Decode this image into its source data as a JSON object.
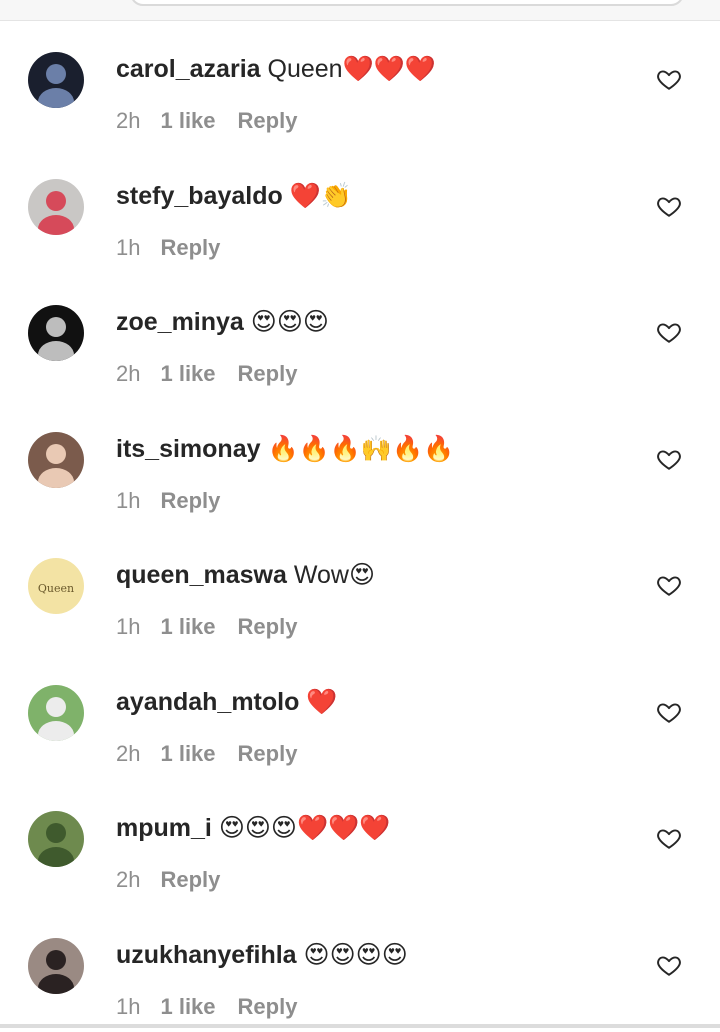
{
  "comments": [
    {
      "username": "carol_azaria",
      "text": "Queen❤️❤️❤️",
      "time": "2h",
      "likes": "1 like",
      "reply": "Reply",
      "avatar": {
        "bg": "#1a1f2e",
        "fg": "#6b7fa8"
      }
    },
    {
      "username": "stefy_bayaldo",
      "text": "❤️👏",
      "time": "1h",
      "likes": "",
      "reply": "Reply",
      "avatar": {
        "bg": "#c9c7c5",
        "fg": "#d64a5a"
      }
    },
    {
      "username": "zoe_minya",
      "text": "😍😍😍",
      "time": "2h",
      "likes": "1 like",
      "reply": "Reply",
      "avatar": {
        "bg": "#111111",
        "fg": "#bdbdbd"
      }
    },
    {
      "username": "its_simonay",
      "text": "🔥🔥🔥🙌🔥🔥",
      "time": "1h",
      "likes": "",
      "reply": "Reply",
      "avatar": {
        "bg": "#7b5b4c",
        "fg": "#e9c9b4"
      }
    },
    {
      "username": "queen_maswa",
      "text": "Wow😍",
      "time": "1h",
      "likes": "1 like",
      "reply": "Reply",
      "avatar": {
        "bg": "#f3e3a4",
        "fg": "#6b5a2c",
        "label": "Queen"
      }
    },
    {
      "username": "ayandah_mtolo",
      "text": "❤️",
      "time": "2h",
      "likes": "1 like",
      "reply": "Reply",
      "avatar": {
        "bg": "#7fb26a",
        "fg": "#ececec"
      }
    },
    {
      "username": "mpum_i",
      "text": "😍😍😍❤️❤️❤️",
      "time": "2h",
      "likes": "",
      "reply": "Reply",
      "avatar": {
        "bg": "#6e8a4e",
        "fg": "#3f5a2d"
      }
    },
    {
      "username": "uzukhanyefihla",
      "text": "😍😍😍😍",
      "time": "1h",
      "likes": "1 like",
      "reply": "Reply",
      "avatar": {
        "bg": "#9a8a83",
        "fg": "#2a2222"
      }
    }
  ],
  "colors": {
    "username": "#262626",
    "meta": "#8e8e8e",
    "heart_outline": "#262626"
  },
  "icons": {
    "like": "heart-outline-icon"
  }
}
